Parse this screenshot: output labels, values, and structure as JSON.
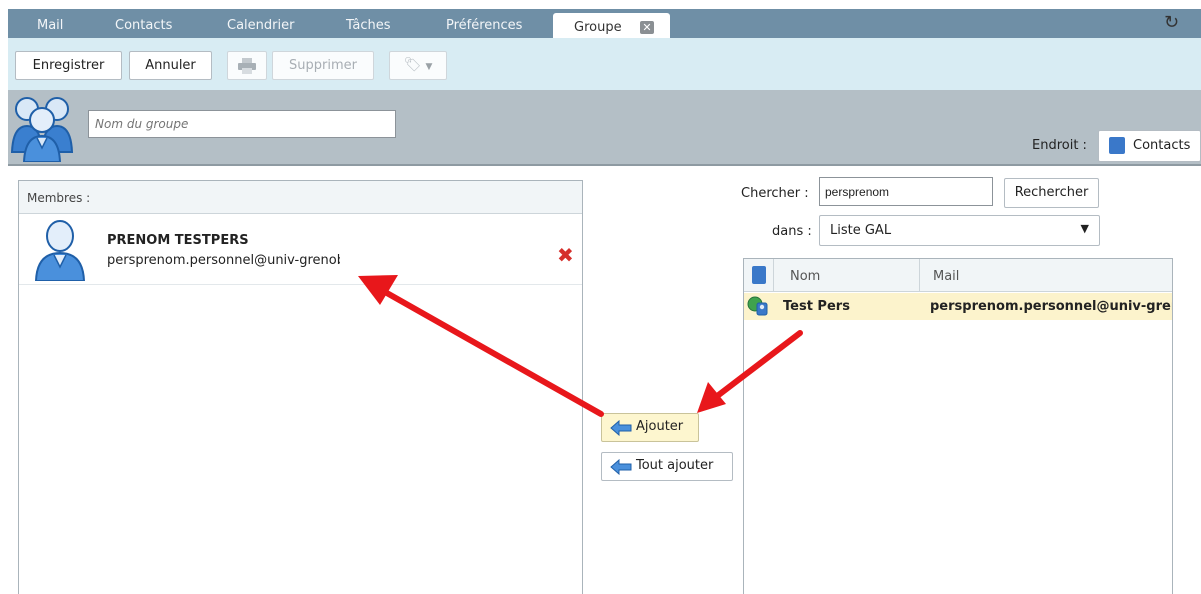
{
  "tabs": {
    "mail": "Mail",
    "contacts": "Contacts",
    "calendar": "Calendrier",
    "tasks": "Tâches",
    "preferences": "Préférences",
    "active": "Groupe"
  },
  "toolbar": {
    "save": "Enregistrer",
    "cancel": "Annuler",
    "delete": "Supprimer"
  },
  "group": {
    "name_placeholder": "Nom du groupe",
    "location_label": "Endroit :",
    "location_value": "Contacts"
  },
  "members": {
    "header": "Membres :",
    "items": [
      {
        "name": "PRENOM TESTPERS",
        "email": "persprenom.personnel@univ-grenoble-alpes.fr"
      }
    ]
  },
  "actions": {
    "add": "Ajouter",
    "add_all": "Tout ajouter"
  },
  "search": {
    "label": "Chercher :",
    "value": "persprenom",
    "button": "Rechercher",
    "in_label": "dans :",
    "in_value": "Liste GAL"
  },
  "results": {
    "columns": {
      "name": "Nom",
      "mail": "Mail"
    },
    "rows": [
      {
        "name": "Test Pers",
        "mail": "persprenom.personnel@univ-grenoble-alpes.fr"
      }
    ]
  },
  "colors": {
    "tab_bar": "#6f8fa6",
    "toolbar": "#d8ecf3",
    "header": "#b4bfc6",
    "highlight": "#fcf3cc",
    "annotation_arrow": "#e8171b",
    "remove": "#d52f2b"
  }
}
